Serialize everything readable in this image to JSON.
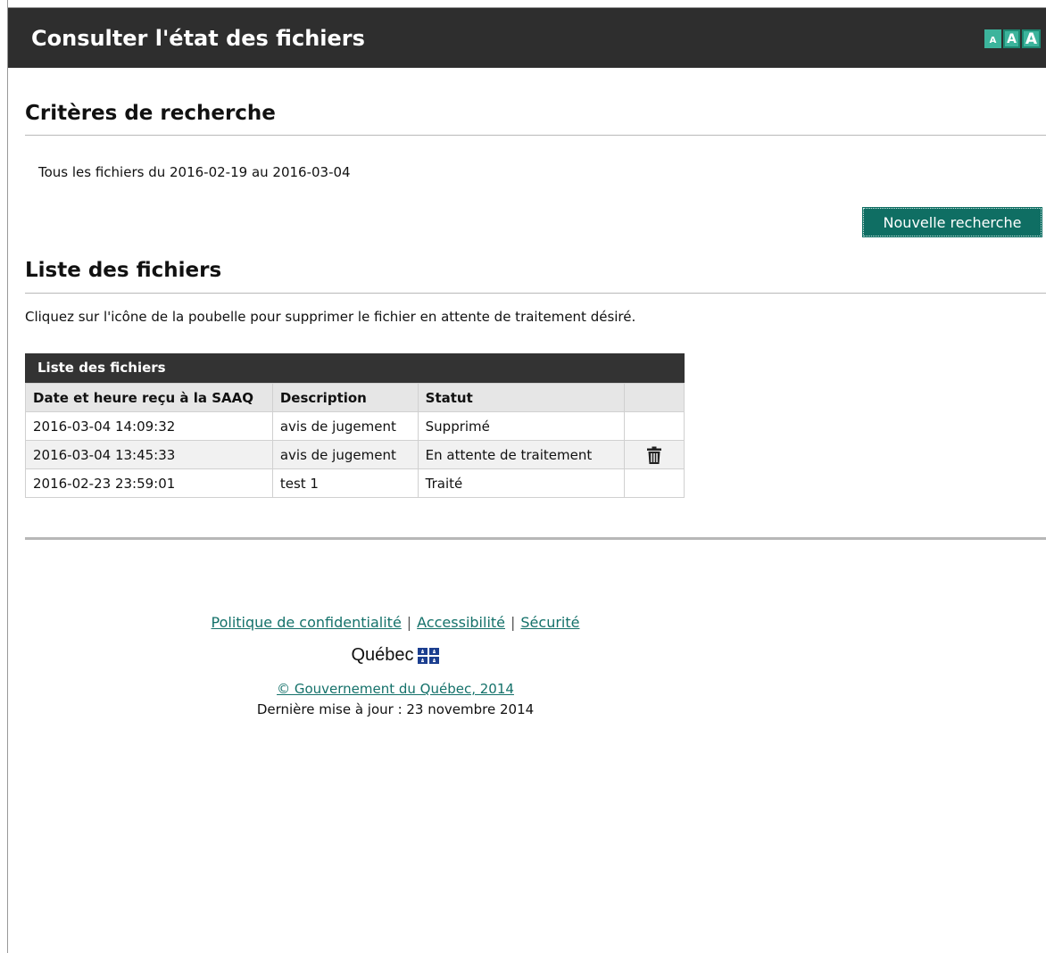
{
  "header": {
    "title": "Consulter l'état des fichiers",
    "font_size_buttons": [
      "A",
      "A",
      "A"
    ]
  },
  "criteria": {
    "title": "Critères de recherche",
    "summary": "Tous les fichiers du 2016-02-19 au 2016-03-04",
    "new_search_label": "Nouvelle recherche"
  },
  "files": {
    "title": "Liste des fichiers",
    "instructions": "Cliquez sur l'icône de la poubelle pour supprimer le fichier en attente de traitement désiré.",
    "table": {
      "caption": "Liste des fichiers",
      "headers": [
        "Date et heure reçu à la SAAQ",
        "Description",
        "Statut",
        ""
      ],
      "rows": [
        {
          "date": "2016-03-04 14:09:32",
          "description": "avis de jugement",
          "status": "Supprimé",
          "action": null
        },
        {
          "date": "2016-03-04 13:45:33",
          "description": "avis de jugement",
          "status": "En attente de traitement",
          "action": "trash-icon"
        },
        {
          "date": "2016-02-23 23:59:01",
          "description": "test 1",
          "status": "Traité",
          "action": null
        }
      ]
    }
  },
  "footer": {
    "links": [
      "Politique de confidentialité",
      "Accessibilité",
      "Sécurité"
    ],
    "separator": "|",
    "logo_text": "Québec",
    "copyright": "© Gouvernement du Québec, 2014",
    "updated": "Dernière mise à jour : 23 novembre 2014"
  },
  "colors": {
    "header_bg": "#2e2e2e",
    "accent": "#0f6e63",
    "font_buttons": "#3cb49c",
    "link": "#14716a",
    "flag_blue": "#1b3e8f"
  }
}
